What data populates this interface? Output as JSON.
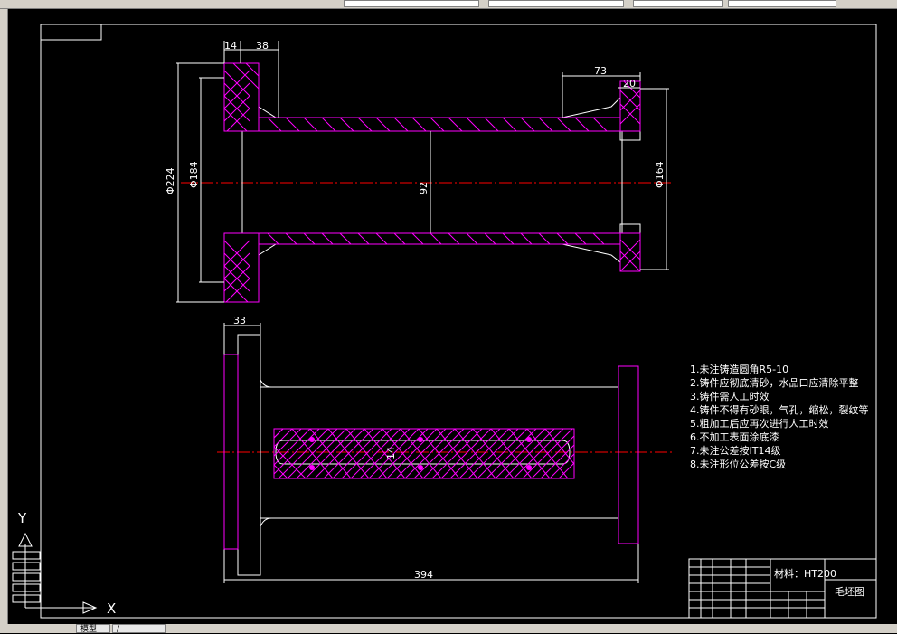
{
  "toolbar": {
    "items": [
      "",
      "",
      "",
      "",
      ""
    ]
  },
  "tabs": {
    "model": "模型",
    "layout": "/"
  },
  "drawing": {
    "dimensions": {
      "d14": "14",
      "d38": "38",
      "d73": "73",
      "d20": "20",
      "phi224": "Φ224",
      "phi184": "Φ184",
      "phi164": "Φ164",
      "d92": "92",
      "d33": "33",
      "d14b": "14",
      "d394": "394"
    },
    "notes": [
      "1.未注铸造圆角R5-10",
      "2.铸件应彻底清砂，水品口应清除平整",
      "3.铸件需人工时效",
      "4.铸件不得有砂眼，气孔，缩松，裂纹等",
      "5.粗加工后应再次进行人工时效",
      "6.不加工表面涂底漆",
      "7.未注公差按IT14级",
      "8.未注形位公差按C级"
    ],
    "title_block": {
      "material": "材料：HT200",
      "drawing_name": "毛坯图"
    },
    "ucs": {
      "y_label": "Y",
      "x_label": "X"
    }
  },
  "colors": {
    "background": "#000000",
    "lines": "#ffffff",
    "hatch": "#ff00ff",
    "centerline": "#ff0000"
  }
}
